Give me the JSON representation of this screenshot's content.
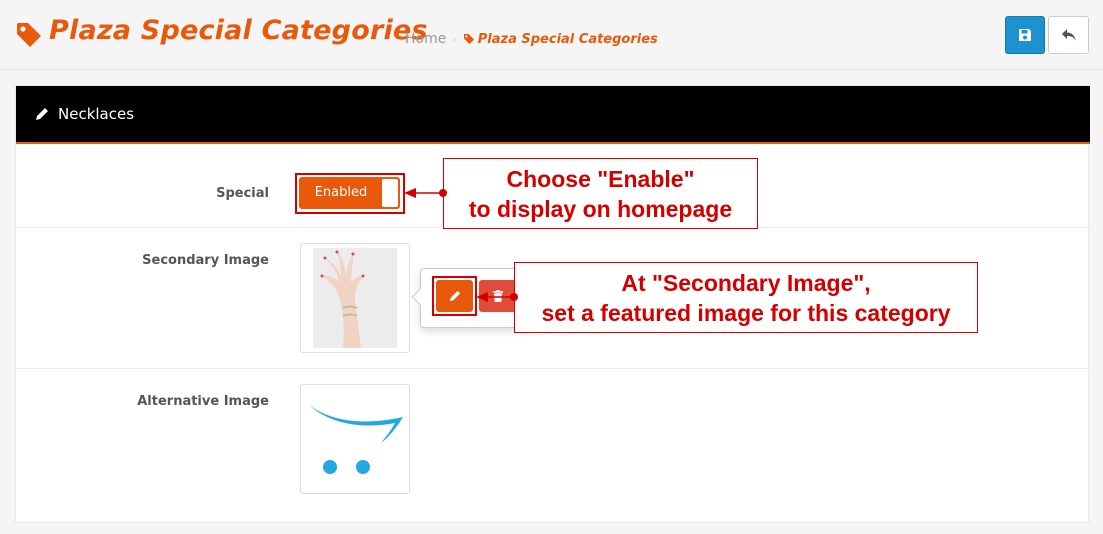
{
  "header": {
    "title": "Plaza Special Categories",
    "breadcrumb": {
      "home": "Home",
      "separator": "›",
      "current": "Plaza Special Categories"
    },
    "buttons": {
      "save_icon": "save-icon",
      "back_icon": "reply-icon"
    }
  },
  "panel": {
    "title": "Necklaces",
    "title_icon": "pencil-icon",
    "fields": {
      "special": {
        "label": "Special",
        "toggle_value": "Enabled"
      },
      "secondary_image": {
        "label": "Secondary Image",
        "image": "hand-with-bracelet-photo"
      },
      "alternative_image": {
        "label": "Alternative Image",
        "image": "opencart-placeholder-logo"
      }
    }
  },
  "callouts": {
    "enable": {
      "line1": "Choose \"Enable\"",
      "line2": "to display on homepage"
    },
    "secondary": {
      "line1": "At \"Secondary Image\",",
      "line2": "set a featured image for this category"
    }
  },
  "colors": {
    "accent": "#e8590c",
    "primary_button": "#1e91cf",
    "danger_button": "#e14c3a",
    "annotation_red": "#d40000",
    "panel_heading": "#000000"
  }
}
